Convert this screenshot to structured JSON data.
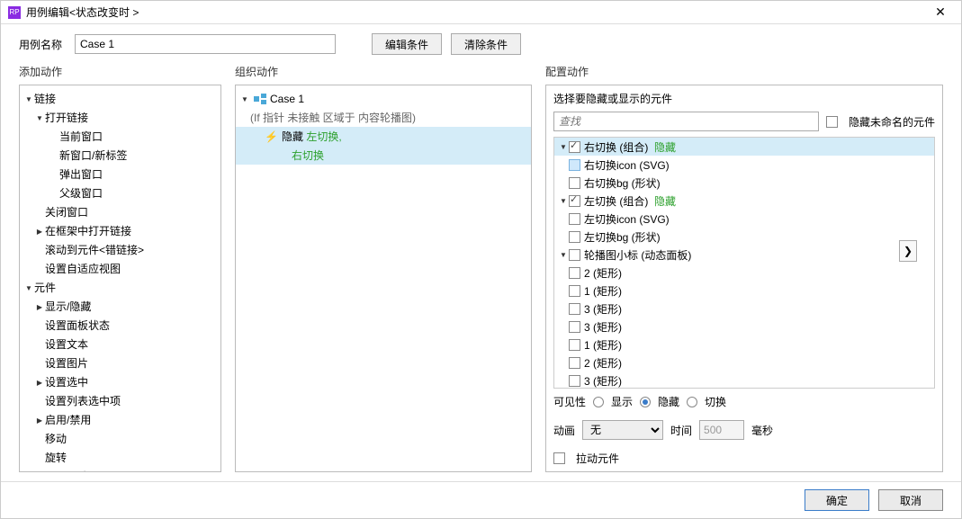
{
  "title": "用例编辑<状态改变时 >",
  "topbar": {
    "label": "用例名称",
    "value": "Case 1",
    "edit_btn": "编辑条件",
    "clear_btn": "清除条件"
  },
  "cols": {
    "left": "添加动作",
    "mid": "组织动作",
    "right": "配置动作"
  },
  "left_tree": {
    "link_cat": "链接",
    "open_link": "打开链接",
    "items_open": [
      "当前窗口",
      "新窗口/新标签",
      "弹出窗口",
      "父级窗口"
    ],
    "close_window": "关闭窗口",
    "open_in_frame": "在框架中打开链接",
    "scroll_to": "滚动到元件<错链接>",
    "set_adaptive": "设置自适应视图",
    "widget_cat": "元件",
    "show_hide": "显示/隐藏",
    "set_panel_state": "设置面板状态",
    "set_text": "设置文本",
    "set_image": "设置图片",
    "set_selected": "设置选中",
    "set_list_selected": "设置列表选中项",
    "enable_disable": "启用/禁用",
    "move": "移动",
    "rotate": "旋转",
    "set_size": "设置尺寸"
  },
  "mid": {
    "case_name": "Case 1",
    "case_cond": "(If 指针 未接触 区域于 内容轮播图)",
    "action_label": "隐藏",
    "targets": [
      "左切换,",
      "右切换"
    ]
  },
  "right": {
    "section_title": "选择要隐藏或显示的元件",
    "search_placeholder": "查找",
    "hide_unnamed": "隐藏未命名的元件",
    "tree": {
      "r_switch": "右切换 (组合)",
      "r_switch_state": "隐藏",
      "r_icon": "右切换icon (SVG)",
      "r_bg": "右切换bg (形状)",
      "l_switch": "左切换 (组合)",
      "l_switch_state": "隐藏",
      "l_icon": "左切换icon (SVG)",
      "l_bg": "左切换bg (形状)",
      "carousel_dots": "轮播图小标  (动态面板)",
      "dots": [
        "2 (矩形)",
        "1 (矩形)",
        "3 (矩形)",
        "3 (矩形)",
        "1 (矩形)",
        "2 (矩形)",
        "3 (矩形)"
      ]
    },
    "visibility_label": "可见性",
    "vis_show": "显示",
    "vis_hide": "隐藏",
    "vis_toggle": "切换",
    "anim_label": "动画",
    "anim_value": "无",
    "time_label": "时间",
    "time_value": "500",
    "time_unit": "毫秒",
    "drag_label": "拉动元件"
  },
  "footer": {
    "ok": "确定",
    "cancel": "取消"
  }
}
